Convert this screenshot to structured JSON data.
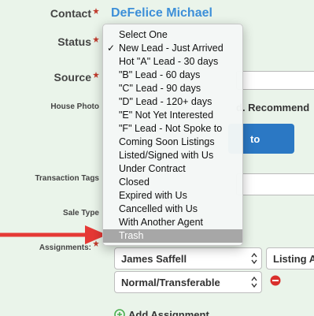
{
  "contact": {
    "label": "Contact",
    "name": "DeFelice Michael"
  },
  "status": {
    "label": "Status"
  },
  "source": {
    "label": "Source"
  },
  "house_photo": {
    "label": "House Photo",
    "note_fragment": "d. Recommend",
    "upload_fragment": "to"
  },
  "transaction_tags": {
    "label": "Transaction Tags"
  },
  "sale_type": {
    "label": "Sale Type"
  },
  "assignments": {
    "label": "Assignments:",
    "agent_select": "James Saffell",
    "role_select": "Listing Ag",
    "type_select": "Normal/Transferable",
    "add_label": "Add Assignment"
  },
  "status_dropdown": {
    "selected": "New Lead - Just Arrived",
    "highlighted": "Trash",
    "options": [
      "Select One",
      "New Lead - Just Arrived",
      "Hot \"A\" Lead - 30 days",
      "\"B\" Lead - 60 days",
      "\"C\" Lead - 90 days",
      "\"D\" Lead - 120+ days",
      "\"E\" Not Yet Interested",
      "\"F\" Lead - Not Spoke to",
      "Coming Soon Listings",
      "Listed/Signed with Us",
      "Under Contract",
      "Closed",
      "Expired with Us",
      "Cancelled with Us",
      "With Another Agent",
      "Trash"
    ]
  },
  "icons": {
    "required": "required-asterisk-icon",
    "check": "checkmark-icon",
    "select_arrows": "select-arrows-icon",
    "remove": "remove-circle-icon",
    "add": "add-circle-icon",
    "annotation": "red-arrow-annotation"
  },
  "colors": {
    "accent": "#3d8fd8",
    "button": "#2b78c4",
    "annotation": "#e53935",
    "remove": "#d9302c",
    "add": "#4caf50"
  }
}
